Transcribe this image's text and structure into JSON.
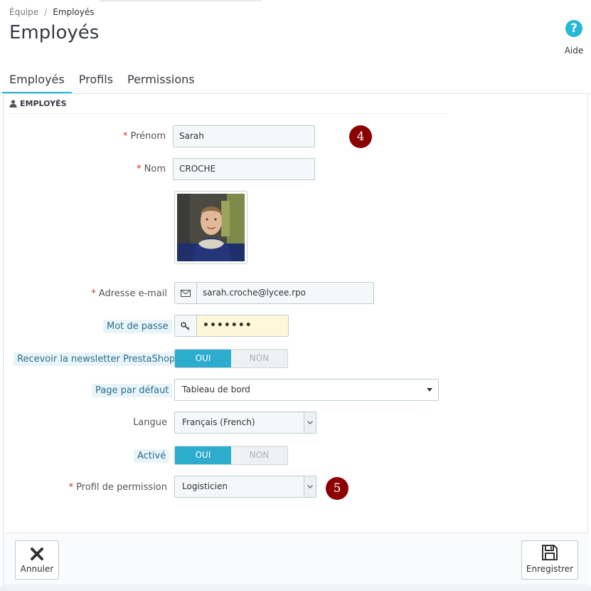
{
  "breadcrumb": {
    "parent": "Équipe",
    "separator": "/",
    "current": "Employés"
  },
  "page_title": "Employés",
  "help": {
    "label": "Aide",
    "glyph": "?"
  },
  "tabs": [
    {
      "label": "Employés",
      "active": true
    },
    {
      "label": "Profils",
      "active": false
    },
    {
      "label": "Permissions",
      "active": false
    }
  ],
  "panel": {
    "title": "EMPLOYÉS"
  },
  "form": {
    "required_mark": "*",
    "firstname": {
      "label": "Prénom",
      "value": "Sarah"
    },
    "lastname": {
      "label": "Nom",
      "value": "CROCHE"
    },
    "email": {
      "label": "Adresse e-mail",
      "value": "sarah.croche@lycee.rpo"
    },
    "password": {
      "label": "Mot de passe",
      "value": "•••••••"
    },
    "newsletter": {
      "label": "Recevoir la newsletter PrestaShop",
      "on": "OUI",
      "off": "NON",
      "selected": "OUI"
    },
    "default_page": {
      "label": "Page par défaut",
      "value": "Tableau de bord"
    },
    "language": {
      "label": "Langue",
      "value": "Français (French)"
    },
    "active": {
      "label": "Activé",
      "on": "OUI",
      "off": "NON",
      "selected": "OUI"
    },
    "profile": {
      "label": "Profil de permission",
      "value": "Logisticien"
    }
  },
  "badges": {
    "first": "4",
    "second": "5"
  },
  "footer": {
    "cancel_label": "Annuler",
    "save_label": "Enregistrer"
  },
  "colors": {
    "accent": "#25b9d7",
    "switch_on": "#2eacce",
    "badge": "#8b0000",
    "required": "#c0392b"
  }
}
